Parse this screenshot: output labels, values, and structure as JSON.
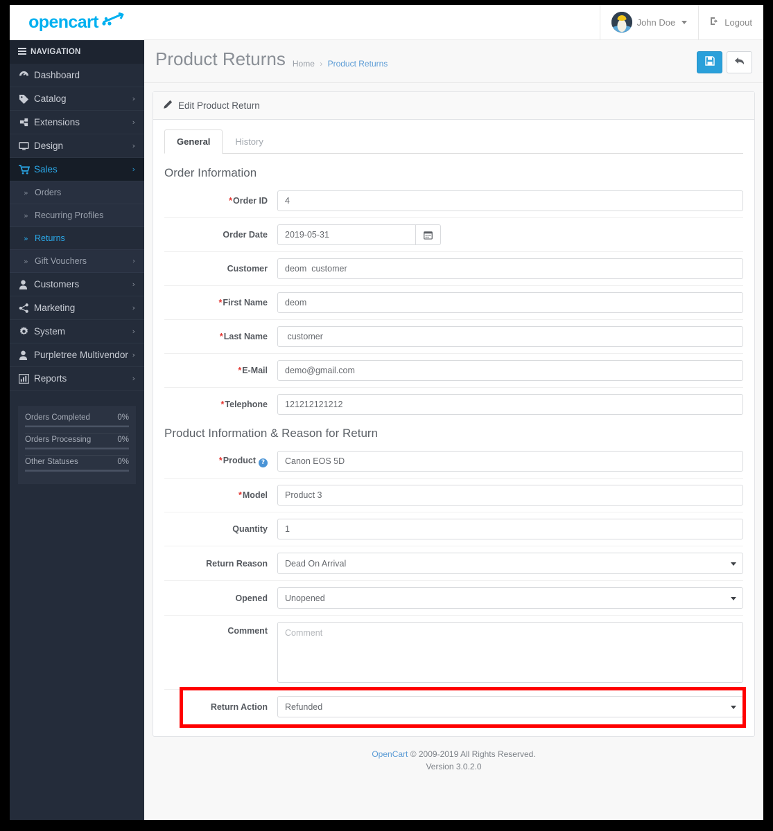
{
  "brand": {
    "name": "opencart"
  },
  "topbar": {
    "user_name": "John Doe",
    "logout_label": "Logout"
  },
  "sidebar": {
    "nav_title": "NAVIGATION",
    "items": [
      {
        "label": "Dashboard",
        "icon": "dashboard-icon",
        "arrow": ""
      },
      {
        "label": "Catalog",
        "icon": "tag-icon",
        "arrow": "›"
      },
      {
        "label": "Extensions",
        "icon": "puzzle-icon",
        "arrow": "›"
      },
      {
        "label": "Design",
        "icon": "desktop-icon",
        "arrow": "›"
      },
      {
        "label": "Sales",
        "icon": "cart-icon",
        "arrow": "›"
      },
      {
        "label": "Customers",
        "icon": "user-icon",
        "arrow": "›"
      },
      {
        "label": "Marketing",
        "icon": "share-icon",
        "arrow": "›"
      },
      {
        "label": "System",
        "icon": "gear-icon",
        "arrow": "›"
      },
      {
        "label": "Purpletree Multivendor",
        "icon": "user-icon",
        "arrow": "›"
      },
      {
        "label": "Reports",
        "icon": "bar-chart-icon",
        "arrow": "›"
      }
    ],
    "sales_subitems": [
      {
        "label": "Orders",
        "arrow": ""
      },
      {
        "label": "Recurring Profiles",
        "arrow": ""
      },
      {
        "label": "Returns",
        "arrow": ""
      },
      {
        "label": "Gift Vouchers",
        "arrow": "›"
      }
    ],
    "stats": [
      {
        "label": "Orders Completed",
        "value": "0%",
        "percent": 0
      },
      {
        "label": "Orders Processing",
        "value": "0%",
        "percent": 0
      },
      {
        "label": "Other Statuses",
        "value": "0%",
        "percent": 0
      }
    ]
  },
  "page": {
    "title": "Product Returns",
    "breadcrumb_home": "Home",
    "breadcrumb_current": "Product Returns",
    "save_icon": "save-icon",
    "back_icon": "back-arrow-icon"
  },
  "panel": {
    "header": "Edit Product Return",
    "header_icon": "pencil-icon",
    "tabs": [
      {
        "label": "General",
        "active": true
      },
      {
        "label": "History",
        "active": false
      }
    ],
    "section_order": "Order Information",
    "section_product": "Product Information & Reason for Return",
    "fields": {
      "order_id": {
        "label": "Order ID",
        "value": "4",
        "required": true
      },
      "order_date": {
        "label": "Order Date",
        "value": "2019-05-31",
        "required": false,
        "addon_icon": "calendar-icon"
      },
      "customer": {
        "label": "Customer",
        "value": "deom  customer",
        "required": false
      },
      "first_name": {
        "label": "First Name",
        "value": "deom",
        "required": true
      },
      "last_name": {
        "label": "Last Name",
        "value": " customer",
        "required": true
      },
      "email": {
        "label": "E-Mail",
        "value": "demo@gmail.com",
        "required": true
      },
      "telephone": {
        "label": "Telephone",
        "value": "121212121212",
        "required": true
      },
      "product": {
        "label": "Product",
        "value": "Canon EOS 5D",
        "required": true,
        "help_icon": "question-circle-icon"
      },
      "model": {
        "label": "Model",
        "value": "Product 3",
        "required": true
      },
      "quantity": {
        "label": "Quantity",
        "value": "1",
        "required": false
      },
      "return_reason": {
        "label": "Return Reason",
        "value": "Dead On Arrival",
        "required": false
      },
      "opened": {
        "label": "Opened",
        "value": "Unopened",
        "required": false
      },
      "comment": {
        "label": "Comment",
        "value": "",
        "placeholder": "Comment",
        "required": false
      },
      "return_action": {
        "label": "Return Action",
        "value": "Refunded",
        "required": false,
        "highlighted": true
      }
    }
  },
  "footer": {
    "link": "OpenCart",
    "copyright": " © 2009-2019 All Rights Reserved.",
    "version": "Version 3.0.2.0"
  },
  "colors": {
    "accent": "#2aa0da",
    "sidebar": "#242c3a",
    "brand": "#00b0f0",
    "required": "#e3342f",
    "highlight": "#ff0000"
  }
}
